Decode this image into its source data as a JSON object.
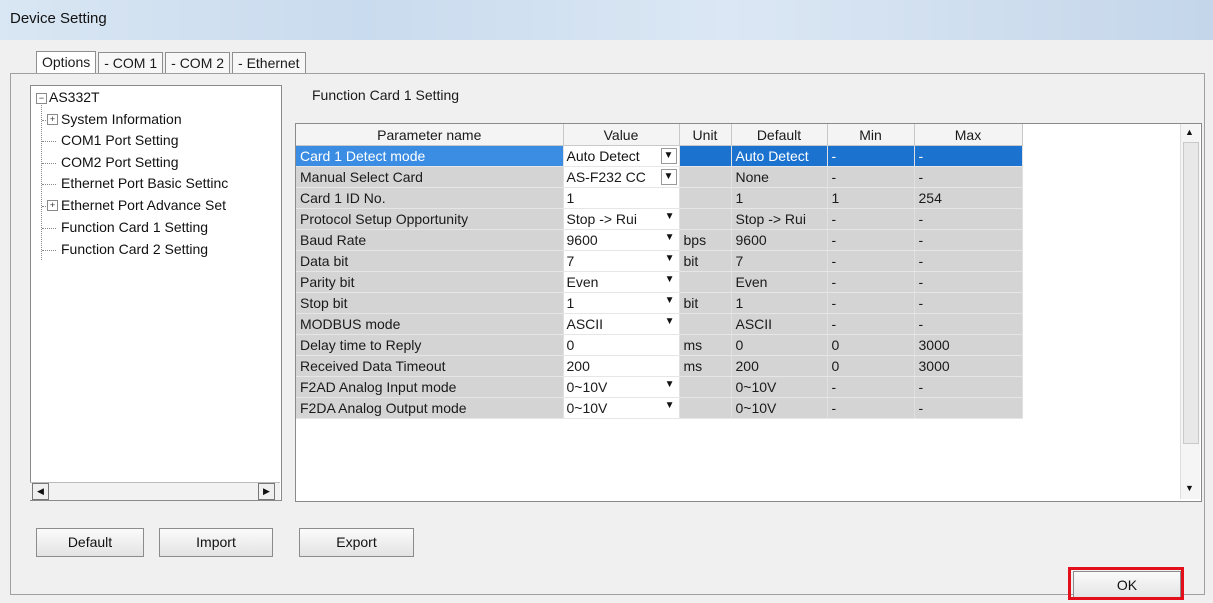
{
  "window": {
    "title": "Device Setting"
  },
  "tabs": [
    "Options",
    "- COM 1",
    "- COM 2",
    "- Ethernet"
  ],
  "tree": {
    "root": "AS332T",
    "items": [
      {
        "label": "System Information",
        "expandable": true
      },
      {
        "label": "COM1 Port Setting",
        "expandable": false
      },
      {
        "label": "COM2 Port Setting",
        "expandable": false
      },
      {
        "label": "Ethernet Port Basic Settinc",
        "expandable": false
      },
      {
        "label": "Ethernet Port Advance Set",
        "expandable": true
      },
      {
        "label": "Function Card 1 Setting",
        "expandable": false
      },
      {
        "label": "Function Card 2 Setting",
        "expandable": false
      }
    ]
  },
  "section_title": "Function Card 1 Setting",
  "grid": {
    "headers": [
      "Parameter name",
      "Value",
      "Unit",
      "Default",
      "Min",
      "Max"
    ],
    "rows": [
      {
        "name": "Card 1 Detect mode",
        "value": "Auto Detect",
        "unit": "",
        "default": "Auto Detect",
        "min": "-",
        "max": "-",
        "dropdown": true
      },
      {
        "name": "Manual Select Card",
        "value": "AS-F232 CC",
        "unit": "",
        "default": "None",
        "min": "-",
        "max": "-",
        "dropdown": true
      },
      {
        "name": "Card 1 ID No.",
        "value": "1",
        "unit": "",
        "default": "1",
        "min": "1",
        "max": "254",
        "dropdown": false
      },
      {
        "name": "Protocol Setup Opportunity",
        "value": "Stop -> Rui",
        "unit": "",
        "default": "Stop -> Rui",
        "min": "-",
        "max": "-",
        "dropdown": true
      },
      {
        "name": "Baud Rate",
        "value": "9600",
        "unit": "bps",
        "default": "9600",
        "min": "-",
        "max": "-",
        "dropdown": true
      },
      {
        "name": "Data bit",
        "value": "7",
        "unit": "bit",
        "default": "7",
        "min": "-",
        "max": "-",
        "dropdown": true
      },
      {
        "name": "Parity bit",
        "value": "Even",
        "unit": "",
        "default": "Even",
        "min": "-",
        "max": "-",
        "dropdown": true
      },
      {
        "name": "Stop bit",
        "value": "1",
        "unit": "bit",
        "default": "1",
        "min": "-",
        "max": "-",
        "dropdown": true
      },
      {
        "name": "MODBUS mode",
        "value": "ASCII",
        "unit": "",
        "default": "ASCII",
        "min": "-",
        "max": "-",
        "dropdown": true
      },
      {
        "name": "Delay time to Reply",
        "value": "0",
        "unit": "ms",
        "default": "0",
        "min": "0",
        "max": "3000",
        "dropdown": false
      },
      {
        "name": "Received Data Timeout",
        "value": "200",
        "unit": "ms",
        "default": "200",
        "min": "0",
        "max": "3000",
        "dropdown": false
      },
      {
        "name": "F2AD Analog Input mode",
        "value": "0~10V",
        "unit": "",
        "default": "0~10V",
        "min": "-",
        "max": "-",
        "dropdown": true
      },
      {
        "name": "F2DA Analog Output mode",
        "value": "0~10V",
        "unit": "",
        "default": "0~10V",
        "min": "-",
        "max": "-",
        "dropdown": true
      }
    ]
  },
  "buttons": {
    "default": "Default",
    "import": "Import",
    "export": "Export",
    "ok": "OK"
  },
  "icons": {
    "scroll_up": "▲",
    "scroll_down": "▼",
    "scroll_left": "◀",
    "scroll_right": "▶",
    "collapse": "−",
    "expand": "+"
  },
  "colors": {
    "selection": "#1c73cf",
    "highlight_outline": "#e3101b"
  }
}
